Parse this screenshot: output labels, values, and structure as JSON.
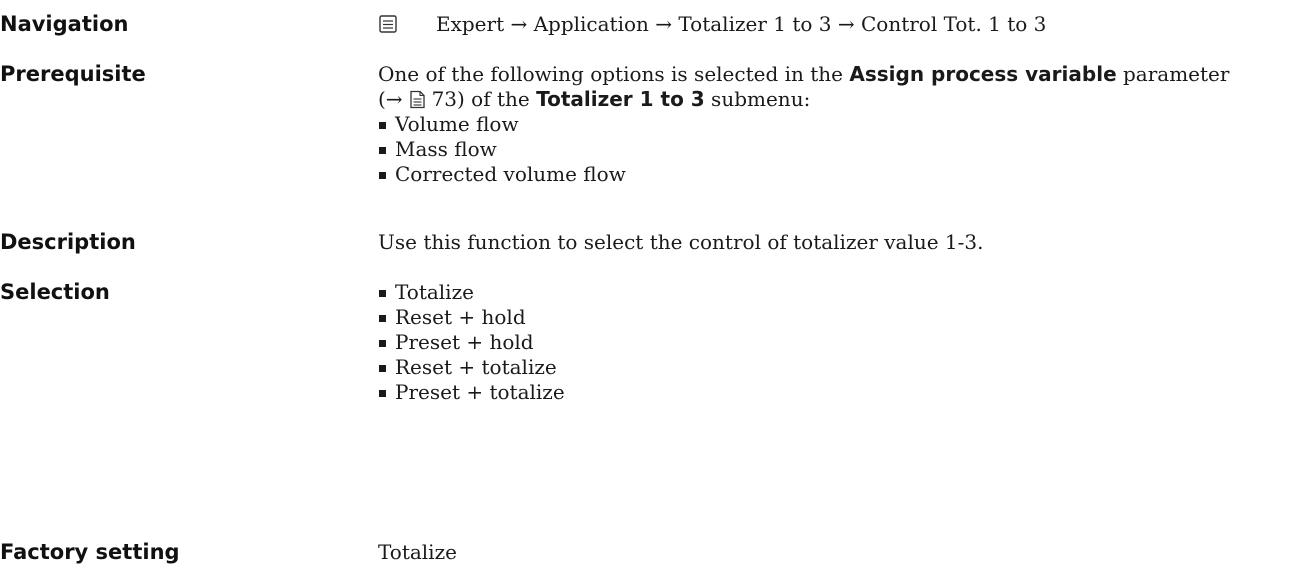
{
  "navigation": {
    "label": "Navigation",
    "icon": "menu-display-icon",
    "path": "Expert → Application → Totalizer 1 to 3 → Control Tot. 1 to 3"
  },
  "prerequisite": {
    "label": "Prerequisite",
    "text_part1": "One of the following options is selected in the ",
    "param_name": "Assign process variable",
    "text_part2": " parameter",
    "ref_arrow": "(→",
    "ref_icon": "page-reference-icon",
    "ref_page": "73)",
    "text_part3": " of the ",
    "submenu_name": "Totalizer 1 to 3",
    "text_part4": " submenu:",
    "options": [
      "Volume flow",
      "Mass flow",
      "Corrected volume flow"
    ]
  },
  "description": {
    "label": "Description",
    "text": "Use this function to select the control of totalizer value 1-3."
  },
  "selection": {
    "label": "Selection",
    "options": [
      "Totalize",
      "Reset + hold",
      "Preset + hold",
      "Reset + totalize",
      "Preset + totalize"
    ]
  },
  "factory_setting": {
    "label": "Factory setting",
    "value": "Totalize"
  }
}
